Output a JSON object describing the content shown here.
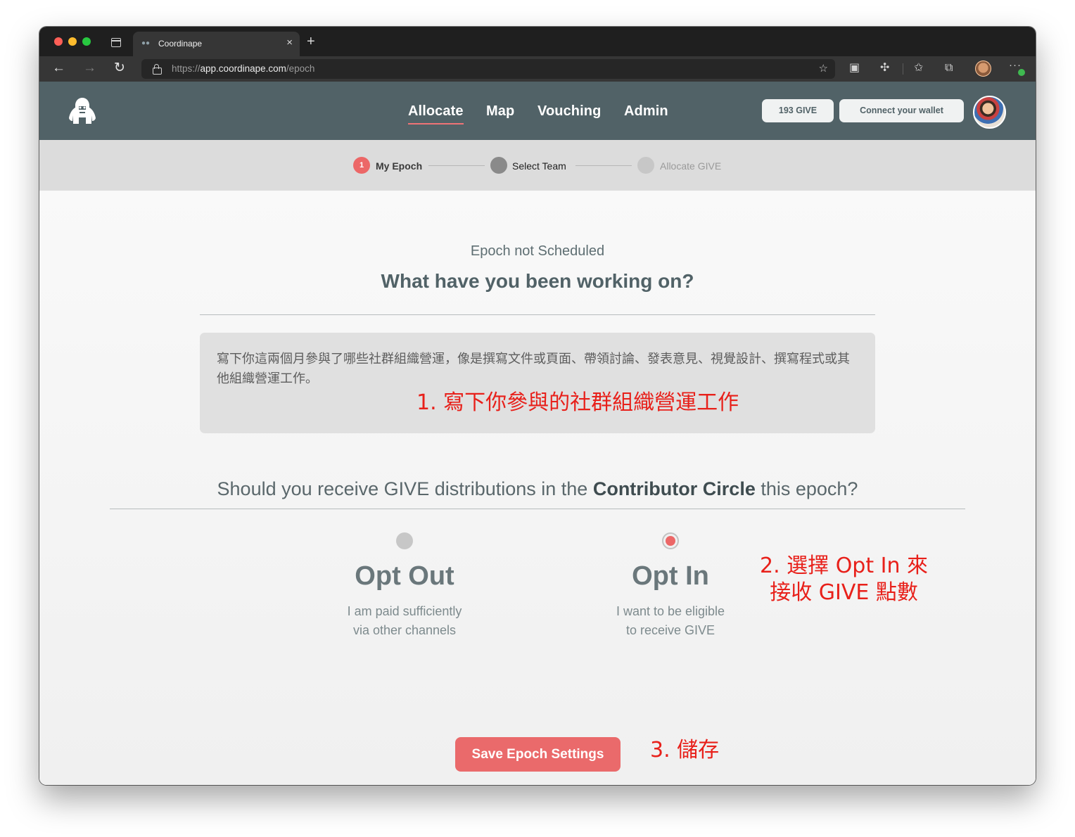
{
  "browser": {
    "tab_title": "Coordinape",
    "tab_close": "×",
    "new_tab": "+",
    "url_scheme": "https://",
    "url_host": "app.coordinape.com",
    "url_path": "/epoch"
  },
  "header": {
    "nav": [
      "Allocate",
      "Map",
      "Vouching",
      "Admin"
    ],
    "active_nav": "Allocate",
    "give_balance": "193 GIVE",
    "wallet_button": "Connect your wallet"
  },
  "stepper": {
    "steps": [
      {
        "number": "1",
        "label": "My Epoch",
        "state": "active",
        "color": "#ec6767"
      },
      {
        "number": "2",
        "label": "Select Team",
        "state": "done",
        "color": "#8a8a8a"
      },
      {
        "number": "3",
        "label": "Allocate GIVE",
        "state": "pending",
        "color": "#c7c7c7"
      }
    ]
  },
  "main": {
    "epoch_status": "Epoch not Scheduled",
    "headline": "What have you been working on?",
    "work_text": "寫下你這兩個月參與了哪些社群組織營運，像是撰寫文件或頁面、帶領討論、發表意見、視覺設計、撰寫程式或其他組織營運工作。",
    "question_prefix": "Should you receive GIVE distributions in the ",
    "question_circle": "Contributor Circle",
    "question_suffix": " this epoch?",
    "opt_out": {
      "title": "Opt Out",
      "desc_line1": "I am paid sufficiently",
      "desc_line2": "via other channels",
      "selected": false
    },
    "opt_in": {
      "title": "Opt In",
      "desc_line1": "I want to be eligible",
      "desc_line2": "to receive GIVE",
      "selected": true
    },
    "save_button": "Save Epoch Settings"
  },
  "annotations": {
    "step1": "1. 寫下你參與的社群組織營運工作",
    "step2_line1": "2. 選擇 Opt In 來",
    "step2_line2": "接收 GIVE 點數",
    "step3": "3. 儲存",
    "color": "#e8201a"
  },
  "colors": {
    "header_bg": "#516267",
    "accent": "#ea6a6b"
  }
}
